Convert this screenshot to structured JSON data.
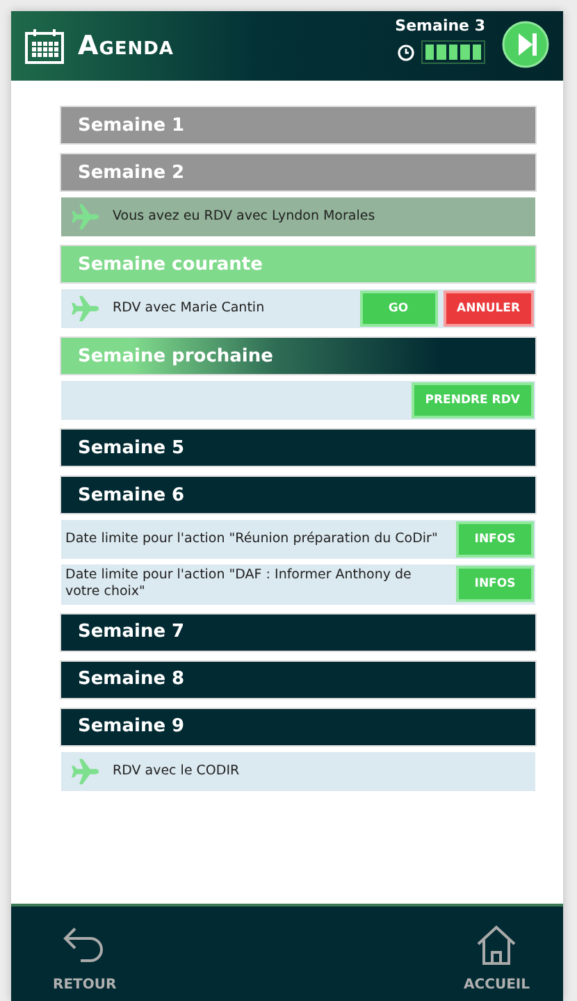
{
  "header": {
    "title": "Agenda",
    "week": "Semaine 3",
    "timer": {
      "level": 1
    }
  },
  "weeks": [
    {
      "label": "Semaine 1",
      "kind": "past"
    },
    {
      "label": "Semaine 2",
      "kind": "past",
      "items": [
        {
          "kind": "rdv",
          "done": true,
          "text": "Vous avez eu RDV avec Lyndon Morales"
        }
      ]
    },
    {
      "label": "Semaine courante",
      "kind": "current",
      "items": [
        {
          "kind": "rdv",
          "done": false,
          "text": "RDV avec Marie Cantin",
          "buttons": [
            {
              "label": "GO",
              "kind": "primary"
            },
            {
              "label": "ANNULER",
              "kind": "danger"
            }
          ]
        }
      ]
    },
    {
      "label": "Semaine prochaine",
      "kind": "next",
      "items": [
        {
          "kind": "slot",
          "done": false,
          "buttons": [
            {
              "label": "PRENDRE RDV",
              "kind": "primary"
            }
          ]
        }
      ]
    },
    {
      "label": "Semaine 5",
      "kind": "future"
    },
    {
      "label": "Semaine 6",
      "kind": "future",
      "items": [
        {
          "kind": "deadline",
          "done": false,
          "text": "Date limite pour l'action \"Réunion préparation du CoDir\"",
          "buttons": [
            {
              "label": "INFOS",
              "kind": "primary"
            }
          ]
        },
        {
          "kind": "deadline",
          "done": false,
          "text": "Date limite pour l'action \"DAF : Informer Anthony de votre choix\"",
          "buttons": [
            {
              "label": "INFOS",
              "kind": "primary"
            }
          ]
        }
      ]
    },
    {
      "label": "Semaine 7",
      "kind": "future"
    },
    {
      "label": "Semaine 8",
      "kind": "future"
    },
    {
      "label": "Semaine 9",
      "kind": "future",
      "items": [
        {
          "kind": "rdv",
          "done": false,
          "text": "RDV avec le CODIR"
        }
      ]
    }
  ],
  "nav": [
    {
      "label": "RETOUR",
      "kind": "back"
    },
    {
      "label": "ACCUEIL",
      "kind": "home"
    }
  ]
}
